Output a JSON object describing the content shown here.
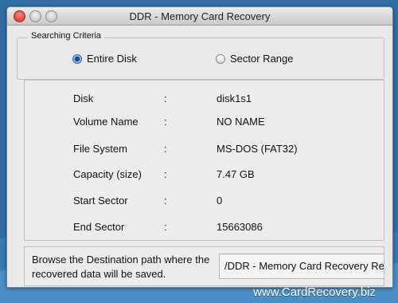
{
  "window": {
    "title": "DDR - Memory Card Recovery"
  },
  "criteria": {
    "legend": "Searching Criteria",
    "options": [
      {
        "label": "Entire Disk",
        "selected": true
      },
      {
        "label": "Sector Range",
        "selected": false
      }
    ]
  },
  "disk_info": {
    "separator": ":",
    "rows": [
      {
        "label": "Disk",
        "value": "disk1s1"
      },
      {
        "label": "Volume Name",
        "value": "NO NAME"
      },
      {
        "label": "File System",
        "value": "MS-DOS (FAT32)"
      },
      {
        "label": "Capacity (size)",
        "value": "7.47  GB"
      },
      {
        "label": "Start Sector",
        "value": "0"
      },
      {
        "label": "End Sector",
        "value": "15663086"
      }
    ]
  },
  "destination": {
    "prompt": "Browse the Destination path where the recovered data will be saved.",
    "path": "/DDR - Memory Card Recovery Re"
  },
  "footer": {
    "url": "www.CardRecovery.biz"
  },
  "colors": {
    "background": "#2f6fa6",
    "close_button": "#d5281c",
    "radio_selected": "#1b4f8f"
  }
}
